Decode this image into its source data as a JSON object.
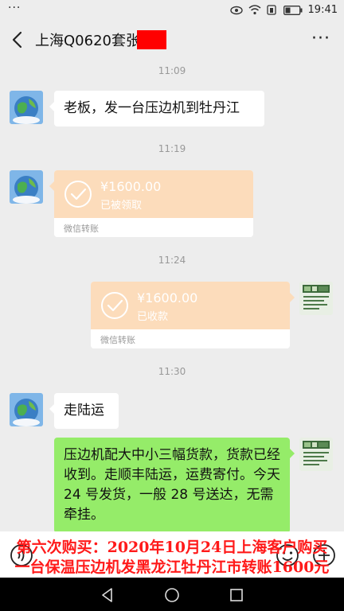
{
  "status_bar": {
    "time": "19:41",
    "dots": "···"
  },
  "header": {
    "title": "上海Q0620套张",
    "more": "···"
  },
  "messages": {
    "t1": "11:09",
    "m1": "老板，发一台压边机到牡丹江",
    "t2": "11:19",
    "tr1": {
      "amount": "¥1600.00",
      "status": "已被领取",
      "footer": "微信转账"
    },
    "t3": "11:24",
    "tr2": {
      "amount": "¥1600.00",
      "status": "已收款",
      "footer": "微信转账"
    },
    "t4": "11:30",
    "m2": "走陆运",
    "m3": "压边机配大中小三幅货款，货款已经收到。走顺丰陆运，运费寄付。今天 24 号发货，一般 28 号送达，无需牵挂。"
  },
  "caption": {
    "line1": "第六次购买：2020年10月24日上海客户购买",
    "line2": "一台保温压边机发黑龙江牡丹江市转账1600元"
  },
  "colors": {
    "transfer_bg": "#fcdcbb",
    "green_bubble": "#95ec69",
    "caption_red": "#ff1a1a",
    "redaction": "#ff0000"
  },
  "icons": [
    "back-arrow-icon",
    "more-icon",
    "check-circle-icon",
    "voice-icon",
    "emoji-icon",
    "plus-icon",
    "nav-back-icon",
    "nav-home-icon",
    "nav-recent-icon"
  ]
}
